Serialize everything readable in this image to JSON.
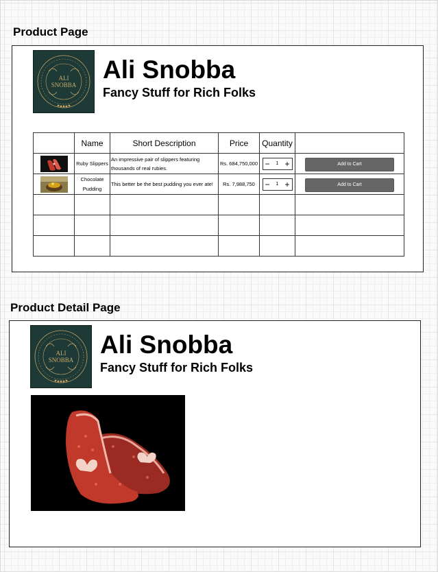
{
  "sections": {
    "product_page_title": "Product Page",
    "detail_page_title": "Product Detail Page"
  },
  "brand": {
    "name": "Ali Snobba",
    "tagline": "Fancy Stuff for Rich Folks",
    "logo_text_line1": "ALI",
    "logo_text_line2": "SNOBBA",
    "logo_ring_text": "LEGENDARY REPUTATION FOR CLASS",
    "colors": {
      "logo_bg": "#1e3a36",
      "logo_gold": "#c9a86a",
      "button_bg": "#666666"
    }
  },
  "table": {
    "headers": [
      "",
      "Name",
      "Short Description",
      "Price",
      "Quantity",
      ""
    ],
    "rows": [
      {
        "name": "Ruby Slippers",
        "description": "An impressive pair of slippers featuring thousands of real rubies.",
        "price": "Rs. 684,750,000",
        "quantity": "1",
        "action": "Add to Cart",
        "thumb_icon": "ruby-slippers-image"
      },
      {
        "name": "Chocolate Pudding",
        "description": "This better be the best pudding you ever ate!",
        "price": "Rs. 7,988,750",
        "quantity": "1",
        "action": "Add to Cart",
        "thumb_icon": "chocolate-pudding-image"
      }
    ],
    "empty_rows": 3
  },
  "stepper": {
    "minus": "−",
    "plus": "+"
  },
  "detail": {
    "image_icon": "ruby-slippers-image"
  }
}
